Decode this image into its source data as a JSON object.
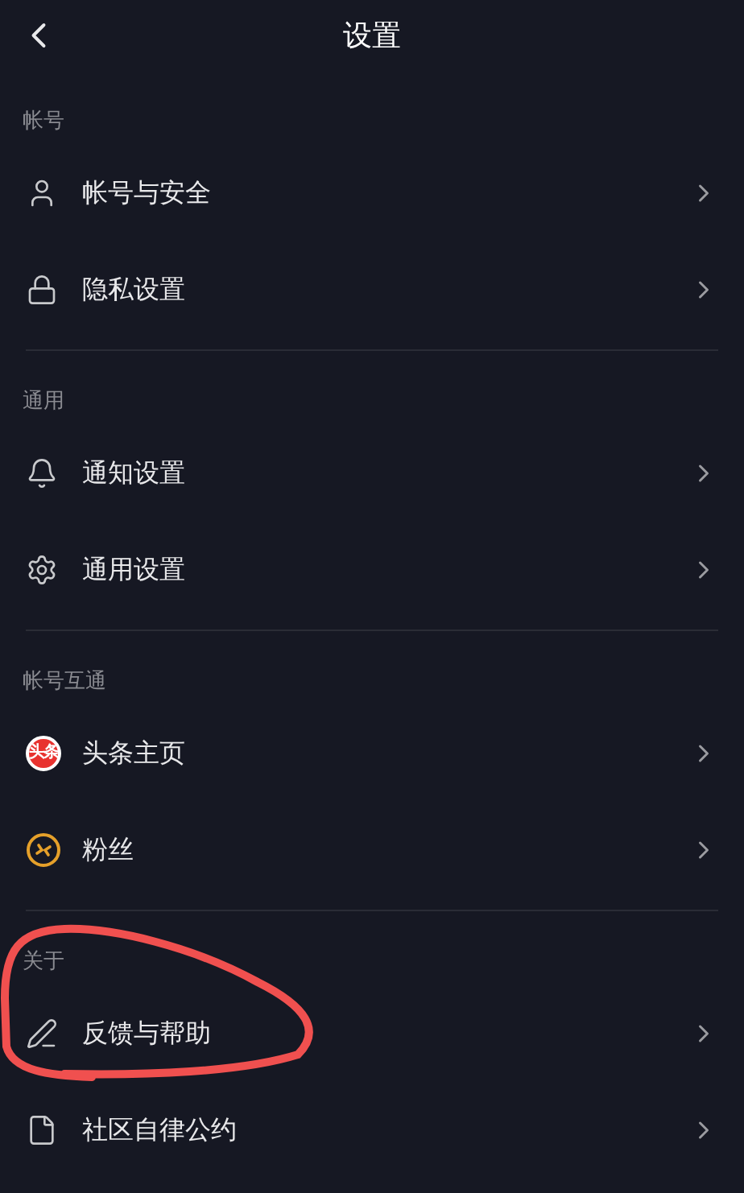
{
  "header": {
    "title": "设置"
  },
  "sections": [
    {
      "label": "帐号",
      "items": [
        {
          "kind": "user",
          "label": "帐号与安全"
        },
        {
          "kind": "lock",
          "label": "隐私设置"
        }
      ]
    },
    {
      "label": "通用",
      "items": [
        {
          "kind": "bell",
          "label": "通知设置"
        },
        {
          "kind": "gear",
          "label": "通用设置"
        }
      ]
    },
    {
      "label": "帐号互通",
      "items": [
        {
          "kind": "logo",
          "label": "头条主页",
          "badge": "头条"
        },
        {
          "kind": "fans",
          "label": "粉丝"
        }
      ]
    },
    {
      "label": "关于",
      "items": [
        {
          "kind": "pen",
          "label": "反馈与帮助"
        },
        {
          "kind": "file",
          "label": "社区自律公约"
        }
      ]
    }
  ]
}
